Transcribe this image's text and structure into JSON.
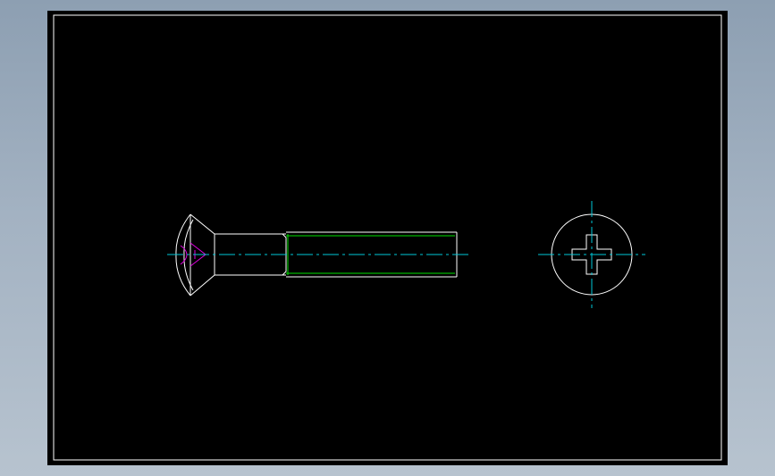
{
  "colors": {
    "background": "#000000",
    "outline": "#ffffff",
    "centerline": "#00c8d8",
    "thread": "#00e000",
    "recess": "#e000e0"
  },
  "views": {
    "side": "screw-side-view",
    "end": "screw-head-end-view"
  },
  "icons": {
    "recess": "cross-recess-icon"
  }
}
